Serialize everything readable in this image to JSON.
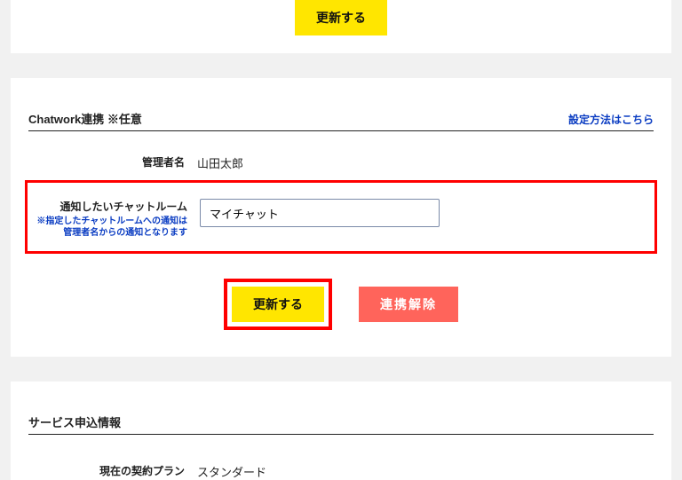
{
  "topButton": {
    "label": "更新する"
  },
  "chatwork": {
    "title": "Chatwork連携 ※任意",
    "helpLink": "設定方法はこちら",
    "adminLabel": "管理者名",
    "adminValue": "山田太郎",
    "roomLabel": "通知したいチャットルーム",
    "roomNote": "※指定したチャットルームへの通知は管理者名からの通知となります",
    "roomValue": "マイチャット",
    "updateBtn": "更新する",
    "unlinkBtn": "連携解除"
  },
  "service": {
    "title": "サービス申込情報",
    "planLabel": "現在の契約プラン",
    "planValue": "スタンダード"
  }
}
